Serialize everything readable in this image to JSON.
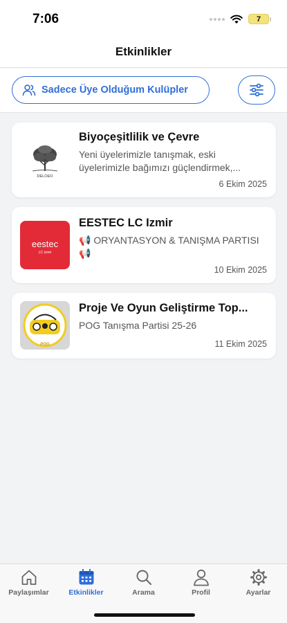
{
  "status_bar": {
    "time": "7:06",
    "battery": "7"
  },
  "header": {
    "title": "Etkinlikler"
  },
  "filters": {
    "club_filter_label": "Sadece Üye Olduğum Kulüpler"
  },
  "events": [
    {
      "club": "Biyoçeşitlilik ve Çevre",
      "description": "Yeni üyelerimizle tanışmak, eski üyelerimizle bağımızı güçlendirmek,...",
      "date": "6 Ekim 2025",
      "logo_text": "DELOEO"
    },
    {
      "club": "EESTEC LC Izmir",
      "description": "📢 ORYANTASYON & TANIŞMA PARTISI 📢",
      "date": "10 Ekim 2025",
      "logo_text": "eestec",
      "logo_subtext": "LC Izmir"
    },
    {
      "club": "Proje Ve Oyun Geliştirme Top...",
      "description": "POG Tanışma Partisi 25-26",
      "date": "11 Ekim 2025",
      "logo_text": "POG"
    }
  ],
  "tabs": [
    {
      "label": "Paylaşımlar",
      "icon": "home-icon"
    },
    {
      "label": "Etkinlikler",
      "icon": "calendar-icon",
      "active": true
    },
    {
      "label": "Arama",
      "icon": "search-icon"
    },
    {
      "label": "Profil",
      "icon": "person-icon"
    },
    {
      "label": "Ayarlar",
      "icon": "gear-icon"
    }
  ],
  "colors": {
    "accent": "#2f6fd8",
    "eestec_red": "#e32b38",
    "pog_yellow": "#f2cc1f"
  }
}
